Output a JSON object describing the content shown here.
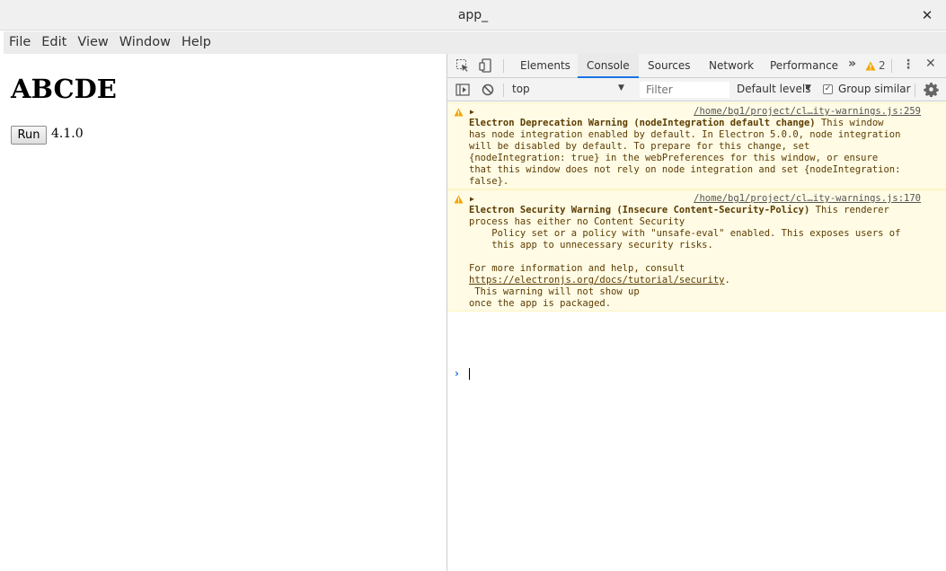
{
  "window": {
    "title": "app_",
    "close_glyph": "✕"
  },
  "menubar": [
    "File",
    "Edit",
    "View",
    "Window",
    "Help"
  ],
  "page": {
    "heading": "ABCDE",
    "run_label": "Run",
    "version": "4.1.0"
  },
  "devtools": {
    "tabs": [
      "Elements",
      "Console",
      "Sources",
      "Network",
      "Performance"
    ],
    "active_tab": "Console",
    "more_glyph": "»",
    "warning_count": "2",
    "close_glyph": "✕",
    "context": "top",
    "filter_placeholder": "Filter",
    "levels": "Default levels",
    "group_similar": "Group similar",
    "group_similar_checked": true,
    "accent": "#1a73e8"
  },
  "console": {
    "messages": [
      {
        "source": "/home/bg1/project/cl…ity-warnings.js:259",
        "title": "Electron Deprecation Warning (nodeIntegration default change)",
        "first_line_rest": " This window",
        "lines": [
          "has node integration enabled by default. In Electron 5.0.0, node integration",
          "will be disabled by default. To prepare for this change, set",
          "{nodeIntegration: true} in the webPreferences for this window, or ensure",
          "that this window does not rely on node integration and set {nodeIntegration:",
          "false}."
        ]
      },
      {
        "source": "/home/bg1/project/cl…ity-warnings.js:170",
        "title": "Electron Security Warning (Insecure Content-Security-Policy)",
        "first_line_rest": " This renderer",
        "lines": [
          "process has either no Content Security",
          "    Policy set or a policy with \"unsafe-eval\" enabled. This exposes users of",
          "    this app to unnecessary security risks.",
          "",
          "For more information and help, consult"
        ],
        "link": "https://electronjs.org/docs/tutorial/security",
        "link_suffix": ".",
        "tail_lines": [
          " This warning will not show up",
          "once the app is packaged."
        ]
      }
    ],
    "prompt": "›",
    "warning_color": "#fffbe5"
  }
}
